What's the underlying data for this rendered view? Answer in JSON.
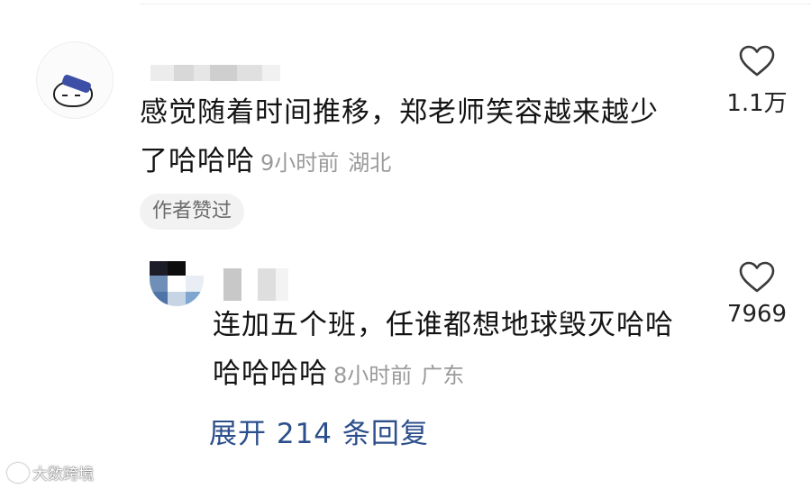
{
  "comment": {
    "text": "感觉随着时间推移，郑老师笑容越来越少了哈哈哈",
    "time": "9小时前",
    "location": "湖北",
    "badge": "作者赞过",
    "likes": "1.1万"
  },
  "reply": {
    "text": "连加五个班，任谁都想地球毁灭哈哈哈哈哈哈",
    "time": "8小时前",
    "location": "广东",
    "likes": "7969",
    "expand_label": "展开 214 条回复"
  },
  "watermark": {
    "text": "大数跨境"
  },
  "icons": {
    "like": "heart-outline-icon",
    "avatar": "cat-avatar-icon"
  },
  "colors": {
    "link": "#2c4f8c",
    "meta": "#9a9a9a",
    "badge_bg": "#f2f2f2"
  }
}
